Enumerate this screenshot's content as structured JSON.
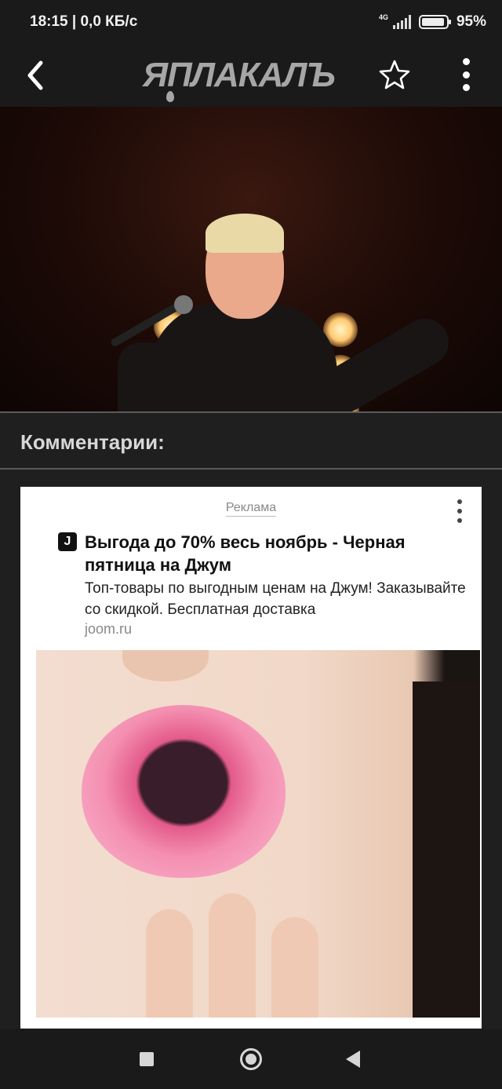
{
  "status_bar": {
    "time_speed": "18:15 | 0,0 КБ/с",
    "network": "4G",
    "battery_percent": "95%",
    "battery_level": 0.95
  },
  "header": {
    "logo_text": "ЯПЛАКАЛЪ",
    "back_icon": "chevron-left-icon",
    "star_icon": "star-outline-icon",
    "more_icon": "more-vertical-icon"
  },
  "comments": {
    "title": "Комментарии:"
  },
  "ad": {
    "label": "Реклама",
    "favicon_letter": "J",
    "title": "Выгода до 70% весь ноябрь - Черная пятница на Джум",
    "description": "Топ-товары по выгодным ценам на Джум! Заказывайте со скидкой. Бесплатная доставка",
    "domain": "joom.ru"
  },
  "nav": {
    "recents_icon": "square-icon",
    "home_icon": "circle-icon",
    "back_icon": "triangle-back-icon"
  },
  "colors": {
    "background": "#1f1f1f",
    "bar": "#1a1a1a",
    "logo": "#a6a6a6",
    "ad_bg": "#ffffff"
  }
}
